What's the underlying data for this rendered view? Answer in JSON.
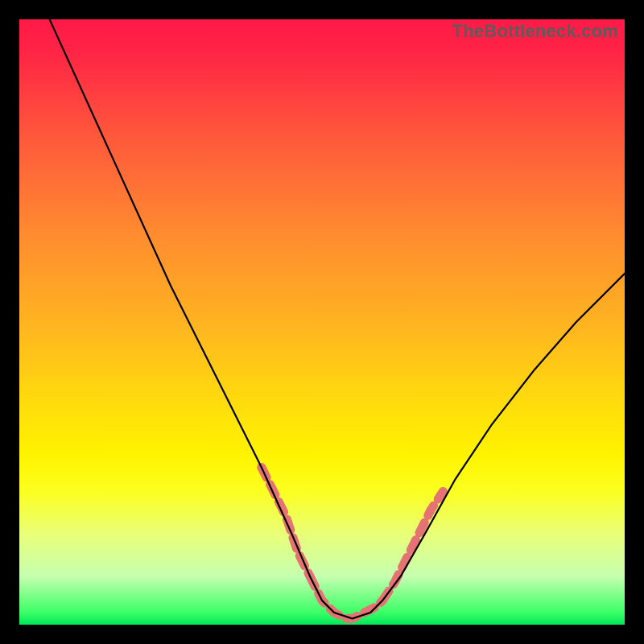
{
  "watermark": {
    "text": "TheBottleneck.com"
  },
  "chart_data": {
    "type": "line",
    "title": "",
    "xlabel": "",
    "ylabel": "",
    "xlim": [
      0,
      100
    ],
    "ylim": [
      0,
      100
    ],
    "series": [
      {
        "name": "curve",
        "x": [
          5,
          10,
          15,
          20,
          25,
          30,
          35,
          40,
          45,
          48,
          50,
          52,
          55,
          58,
          60,
          63,
          67,
          72,
          78,
          85,
          92,
          100
        ],
        "values": [
          100,
          89,
          78,
          67,
          56,
          46,
          36,
          26,
          15,
          8,
          4,
          2,
          1,
          2,
          4,
          8,
          15,
          24,
          33,
          42,
          50,
          58
        ]
      },
      {
        "name": "highlight-left",
        "x": [
          40,
          41,
          42,
          43,
          44,
          45,
          46,
          47,
          48
        ],
        "values": [
          26,
          24,
          22,
          20,
          18,
          15,
          12,
          10,
          8
        ]
      },
      {
        "name": "highlight-bottom",
        "x": [
          48,
          49,
          50,
          51,
          52,
          53,
          54,
          55,
          56,
          57,
          58,
          59,
          60
        ],
        "values": [
          8,
          6,
          4,
          3,
          2,
          1.5,
          1,
          1,
          1.5,
          2,
          2.5,
          3,
          4
        ]
      },
      {
        "name": "highlight-right",
        "x": [
          60,
          62,
          64,
          66,
          68,
          70
        ],
        "values": [
          4,
          7,
          11,
          15,
          19,
          22
        ]
      }
    ],
    "colors": {
      "curve": "#000000",
      "highlight": "#e57373"
    }
  }
}
